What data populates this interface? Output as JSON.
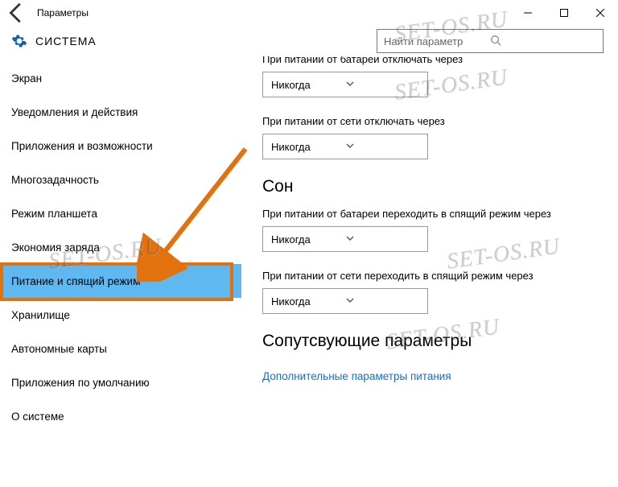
{
  "titlebar": {
    "title": "Параметры"
  },
  "header": {
    "section": "СИСТЕМА",
    "search_placeholder": "Найти параметр"
  },
  "sidebar": {
    "items": [
      "Экран",
      "Уведомления и действия",
      "Приложения и возможности",
      "Многозадачность",
      "Режим планшета",
      "Экономия заряда",
      "Питание и спящий режим",
      "Хранилище",
      "Автономные карты",
      "Приложения по умолчанию",
      "О системе"
    ],
    "selected_index": 6
  },
  "main": {
    "screen": {
      "label_battery": "При питании от батареи отключать через",
      "value_battery": "Никогда",
      "label_plugged": "При питании от сети отключать через",
      "value_plugged": "Никогда"
    },
    "sleep": {
      "heading": "Сон",
      "label_battery": "При питании от батареи переходить в спящий режим через",
      "value_battery": "Никогда",
      "label_plugged": "При питании от сети переходить в спящий режим через",
      "value_plugged": "Никогда"
    },
    "related": {
      "heading": "Сопутсвующие параметры",
      "link": "Дополнительные параметры питания"
    }
  },
  "watermark": "SET-OS.RU"
}
